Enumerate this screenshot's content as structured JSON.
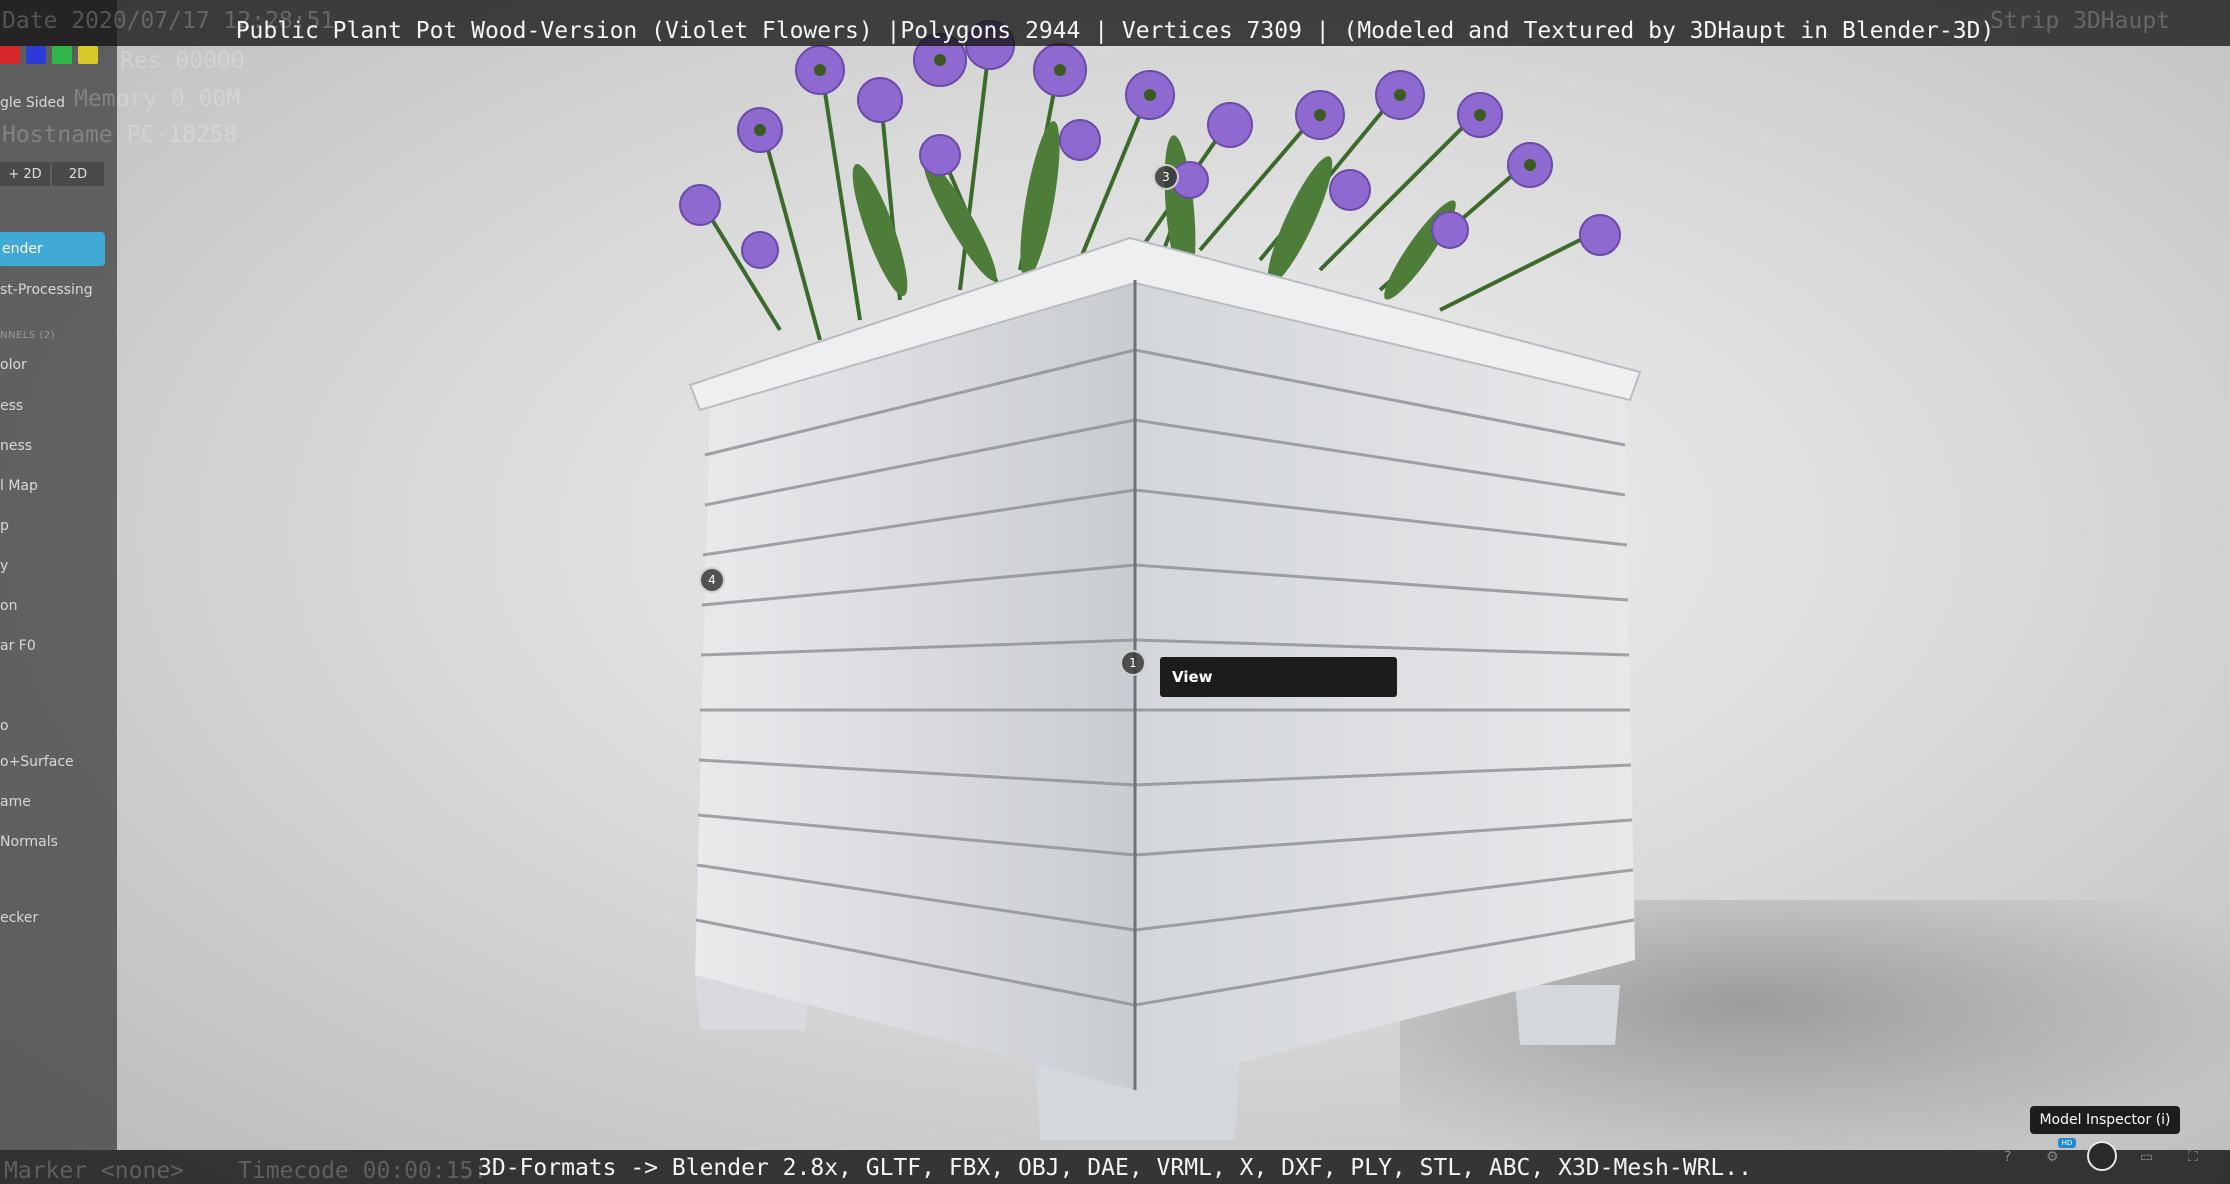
{
  "header": {
    "title": "Public Plant Pot Wood-Version (Violet Flowers) |Polygons 2944 | Vertices 7309 | (Modeled and Textured by 3DHaupt in Blender-3D)",
    "ghost_date": "Date 2020/07/17 12:28:51",
    "ghost_strip": "Strip 3DHaupt",
    "ghost_mem": "Memory 0.00M",
    "ghost_host": "Hostname PC-18258",
    "ghost_res": "Res 00000"
  },
  "footer": {
    "formats": "3D-Formats -> Blender 2.8x, GLTF, FBX, OBJ, DAE, VRML, X, DXF, PLY, STL, ABC, X3D-Mesh-WRL..",
    "ghost_marker": "Marker <none>",
    "ghost_timecode": "Timecode 00:00:15:"
  },
  "sidebar": {
    "swatch_colors": [
      "#d8262b",
      "#2b3bd6",
      "#2fb84a",
      "#d6c928"
    ],
    "single_sided": "gle Sided",
    "seg_a": "+ 2D",
    "seg_b": "2D",
    "active": "ender",
    "post_processing": "st-Processing",
    "channels_header": "NNELS (2)",
    "items": [
      "olor",
      "ess",
      "ness",
      "l Map",
      "p",
      "y",
      "on",
      "ar F0",
      "",
      "o",
      "o+Surface",
      "ame",
      "Normals",
      "",
      "ecker"
    ]
  },
  "hotspots": [
    "1",
    "3",
    "4"
  ],
  "annotation": {
    "label": "View"
  },
  "tooltip": {
    "label": "Model Inspector (i)"
  },
  "toolbar": {
    "help_icon": "?",
    "hd_badge": "HD"
  },
  "colors": {
    "accent": "#41a9d6",
    "flower": "#8e6ad0",
    "wood": "#d9dce0"
  }
}
